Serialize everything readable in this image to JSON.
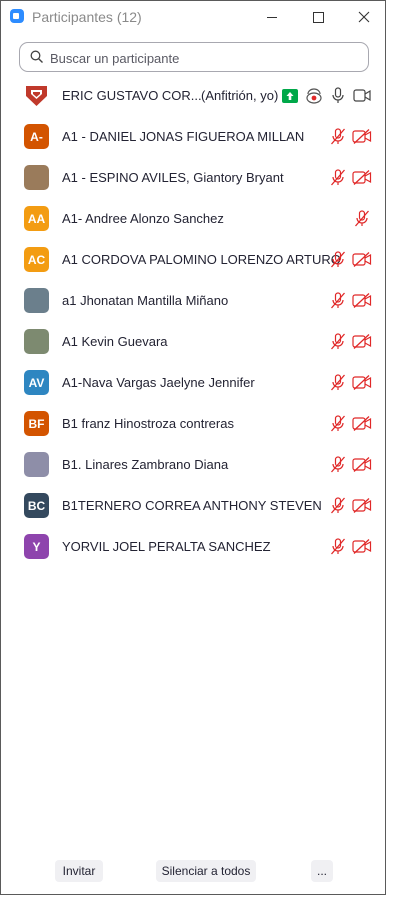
{
  "window": {
    "title": "Participantes (12)"
  },
  "search": {
    "placeholder": "Buscar un participante"
  },
  "host": {
    "name": "ERIC GUSTAVO COR...",
    "role": "(Anfitrión, yo)"
  },
  "participants": [
    {
      "initials": "A-",
      "color": "#d35400",
      "name": "A1 - DANIEL JONAS FIGUEROA MILLAN",
      "video_muted": true
    },
    {
      "initials": "",
      "color": "#9a7b5b",
      "name": "A1 - ESPINO AVILES, Giantory Bryant",
      "video_muted": true
    },
    {
      "initials": "AA",
      "color": "#f39c12",
      "name": "A1- Andree Alonzo Sanchez",
      "video_muted": false
    },
    {
      "initials": "AC",
      "color": "#f39c12",
      "name": "A1 CORDOVA PALOMINO LORENZO ARTURO",
      "video_muted": true
    },
    {
      "initials": "",
      "color": "#6b7f8c",
      "name": "a1 Jhonatan Mantilla Miñano",
      "video_muted": true
    },
    {
      "initials": "",
      "color": "#7d8a70",
      "name": "A1 Kevin Guevara",
      "video_muted": true
    },
    {
      "initials": "AV",
      "color": "#2e86c1",
      "name": "A1-Nava Vargas Jaelyne Jennifer",
      "video_muted": true
    },
    {
      "initials": "BF",
      "color": "#d35400",
      "name": "B1 franz Hinostroza contreras",
      "video_muted": true
    },
    {
      "initials": "",
      "color": "#8e8ea8",
      "name": "B1. Linares Zambrano Diana",
      "video_muted": true
    },
    {
      "initials": "BC",
      "color": "#34495e",
      "name": "B1TERNERO CORREA ANTHONY STEVEN",
      "video_muted": true
    },
    {
      "initials": "Y",
      "color": "#8e44ad",
      "name": "YORVIL JOEL PERALTA SANCHEZ",
      "video_muted": true
    }
  ],
  "footer": {
    "invite": "Invitar",
    "mute_all": "Silenciar a todos",
    "more": "..."
  },
  "colors": {
    "muted_red": "#e02828",
    "share_green": "#00a849",
    "accent_blue": "#2d8cff"
  }
}
